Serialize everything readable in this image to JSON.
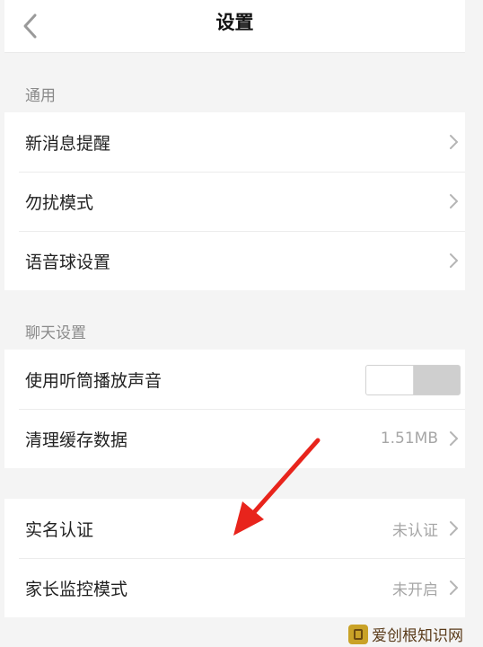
{
  "header": {
    "title": "设置",
    "back_icon": "chevron-left-icon"
  },
  "sections": {
    "general": {
      "label": "通用",
      "items": [
        {
          "label": "新消息提醒"
        },
        {
          "label": "勿扰模式"
        },
        {
          "label": "语音球设置"
        }
      ]
    },
    "chat": {
      "label": "聊天设置",
      "items": [
        {
          "label": "使用听筒播放声音",
          "toggle_on": false
        },
        {
          "label": "清理缓存数据",
          "value": "1.51MB"
        }
      ]
    },
    "account": {
      "items": [
        {
          "label": "实名认证",
          "value": "未认证"
        },
        {
          "label": "家长监控模式",
          "value": "未开启"
        }
      ]
    }
  },
  "annotation": {
    "arrow_color": "#e8241c"
  },
  "watermark": {
    "text": "爱创根知识网"
  }
}
